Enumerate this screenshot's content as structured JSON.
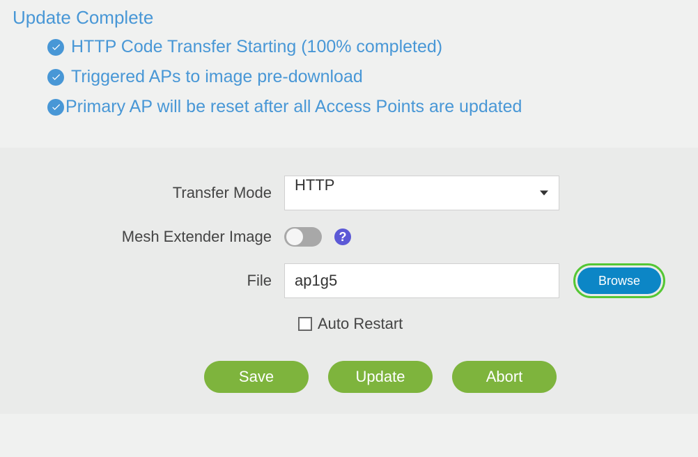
{
  "status": {
    "title": "Update Complete",
    "items": [
      "HTTP Code Transfer Starting (100% completed)",
      "Triggered APs to image pre-download",
      "Primary AP will be reset after all Access Points are updated"
    ]
  },
  "form": {
    "transfer_mode": {
      "label": "Transfer Mode",
      "value": "HTTP"
    },
    "mesh_extender": {
      "label": "Mesh Extender Image",
      "enabled": false
    },
    "file": {
      "label": "File",
      "value": "ap1g5",
      "browse_label": "Browse"
    },
    "auto_restart": {
      "label": "Auto Restart",
      "checked": false
    }
  },
  "buttons": {
    "save": "Save",
    "update": "Update",
    "abort": "Abort"
  }
}
